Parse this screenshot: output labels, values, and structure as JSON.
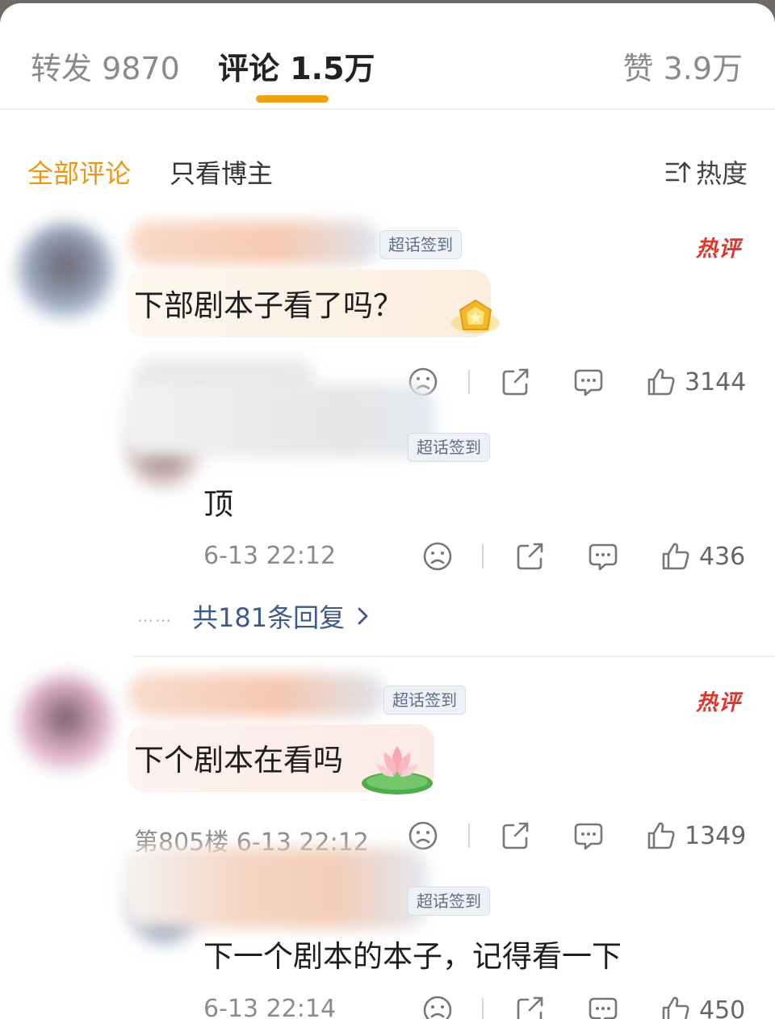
{
  "tabs": [
    {
      "label": "转发 9870",
      "active": false
    },
    {
      "label": "评论 1.5万",
      "active": true
    },
    {
      "label": "赞 3.9万",
      "active": false
    }
  ],
  "filters": {
    "all": "全部评论",
    "blogger_only": "只看博主",
    "sort": "热度"
  },
  "colors": {
    "accent": "#f0a20e",
    "hot": "#e0352a",
    "link": "#3d5b8a"
  },
  "comments": [
    {
      "badge": "超话签到",
      "hot": "热评",
      "text": "下部剧本子看了吗？",
      "meta": "",
      "like_count": "3144",
      "reply": {
        "badge": "超话签到",
        "text": "顶",
        "meta": "6-13 22:12",
        "like_count": "436"
      },
      "more_replies": "共181条回复",
      "dots": "……"
    },
    {
      "badge": "超话签到",
      "hot": "热评",
      "text": "下个剧本在看吗",
      "meta": "第805楼 6-13 22:12",
      "like_count": "1349",
      "reply": {
        "badge": "超话签到",
        "text": "下一个剧本的本子，记得看一下",
        "meta": "6-13 22:14",
        "like_count": "450"
      }
    }
  ],
  "icons": [
    "sort-icon",
    "dislike-icon",
    "share-icon",
    "comment-icon",
    "like-icon",
    "chevron-right-icon"
  ]
}
